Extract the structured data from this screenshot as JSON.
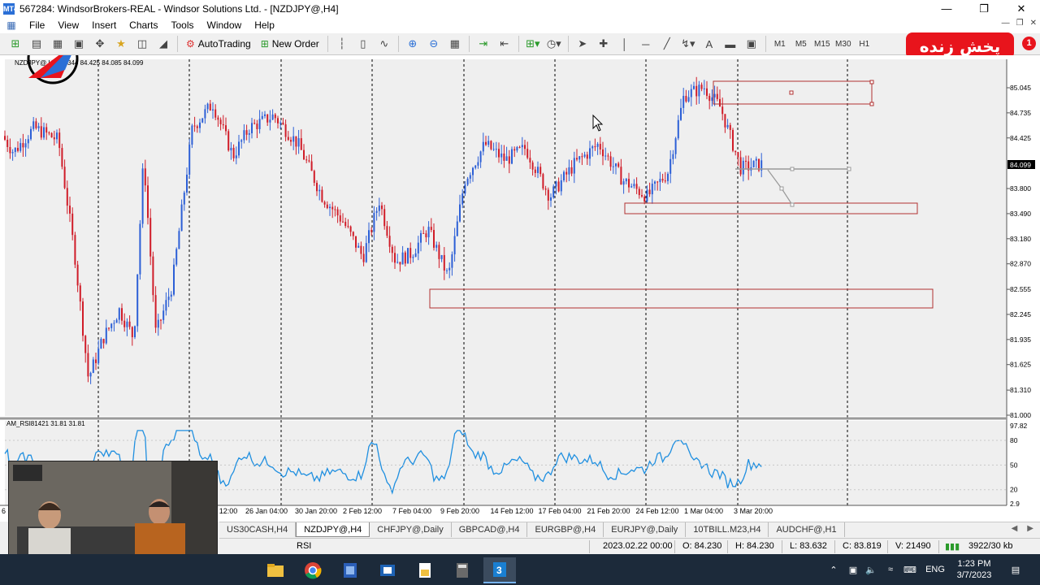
{
  "window": {
    "title": "567284: WindsorBrokers-REAL - Windsor Solutions Ltd. - [NZDJPY@,H4]",
    "app_icon": "MT4",
    "controls": [
      "minimize-icon",
      "restore-icon",
      "close-icon"
    ]
  },
  "menu": {
    "items": [
      "File",
      "View",
      "Insert",
      "Charts",
      "Tools",
      "Window",
      "Help"
    ]
  },
  "toolbar": {
    "autotrading_label": "AutoTrading",
    "new_order_label": "New Order",
    "text_tool": "A",
    "timeframes": [
      "M1",
      "M5",
      "M15",
      "M30",
      "H1"
    ]
  },
  "overlay": {
    "live_badge": "پخش زنده",
    "notification_count": "1"
  },
  "chart": {
    "symbol_info": "NZDJPY@,H4 84.344 84.425 84.085 84.099",
    "current_price": "84.099",
    "bull_color": "#2c5fd6",
    "bear_color": "#d01c28",
    "zone_color": "#b03030",
    "price_ticks": [
      "85.045",
      "84.735",
      "84.425",
      "84.099",
      "83.800",
      "83.490",
      "83.180",
      "82.870",
      "82.555",
      "82.245",
      "81.935",
      "81.625",
      "81.310",
      "81.000"
    ],
    "time_labels": [
      "12:00",
      "26 Jan 04:00",
      "30 Jan 20:00",
      "2 Feb 12:00",
      "7 Feb 04:00",
      "9 Feb 20:00",
      "14 Feb 12:00",
      "17 Feb 04:00",
      "21 Feb 20:00",
      "24 Feb 12:00",
      "1 Mar 04:00",
      "3 Mar 20:00"
    ],
    "left_edge_label": "6"
  },
  "indicator": {
    "label": "AM_RSI81421 31.81 31.81",
    "line_color": "#1f8fe0",
    "scale_ticks": [
      "97.82",
      "80",
      "50",
      "20",
      "2.9"
    ]
  },
  "tabs": [
    "US30CASH,H4",
    "NZDJPY@,H4",
    "CHFJPY@,Daily",
    "GBPCAD@,H4",
    "EURGBP@,H4",
    "EURJPY@,Daily",
    "10TBILL.M23,H4",
    "AUDCHF@,H1"
  ],
  "active_tab": "NZDJPY@,H4",
  "status": {
    "indicator": "RSI",
    "datetime": "2023.02.22 00:00",
    "open": "O: 84.230",
    "high": "H: 84.230",
    "low": "L: 83.632",
    "close": "C: 83.819",
    "volume": "V: 21490",
    "traffic": "3922/30 kb"
  },
  "taskbar": {
    "apps": [
      "file-explorer-icon",
      "chrome-icon",
      "network-app-icon",
      "outlook-icon",
      "file-manager-icon",
      "calculator-icon",
      "metatrader-icon"
    ],
    "language": "ENG",
    "time": "1:23 PM",
    "date": "3/7/2023"
  },
  "webcam": {
    "description_icon": "video-feed"
  }
}
